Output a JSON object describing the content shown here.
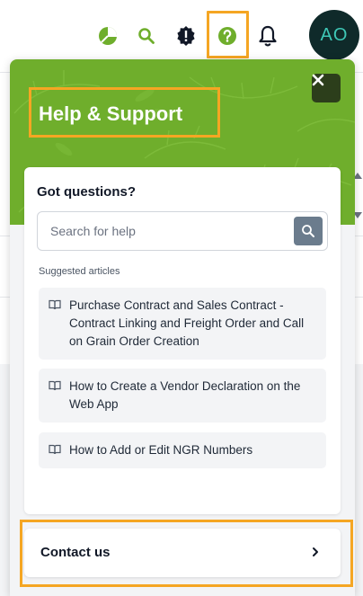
{
  "topbar": {
    "icons": [
      "dashboard-pie-icon",
      "search-icon",
      "alert-badge-icon",
      "help-icon",
      "bell-icon"
    ],
    "avatar_initials": "AO",
    "colors": {
      "brand_green": "#6fae2c",
      "avatar_bg": "#0f2a2a",
      "avatar_text": "#3ec7b6",
      "highlight": "#f5a623"
    }
  },
  "panel": {
    "title": "Help & Support",
    "close_icon": "close-icon",
    "card": {
      "heading": "Got questions?",
      "search": {
        "placeholder": "Search for help",
        "value": ""
      },
      "suggested_heading": "Suggested articles",
      "articles": [
        {
          "title": "Purchase Contract and Sales Contract - Contract Linking and Freight Order and Call on Grain Order Creation",
          "icon": "book-icon"
        },
        {
          "title": "How to Create a Vendor Declaration on the Web App",
          "icon": "book-icon"
        },
        {
          "title": "How to Add or Edit NGR Numbers",
          "icon": "book-icon"
        }
      ]
    },
    "contact": {
      "label": "Contact us",
      "icon": "chevron-right-icon"
    }
  }
}
